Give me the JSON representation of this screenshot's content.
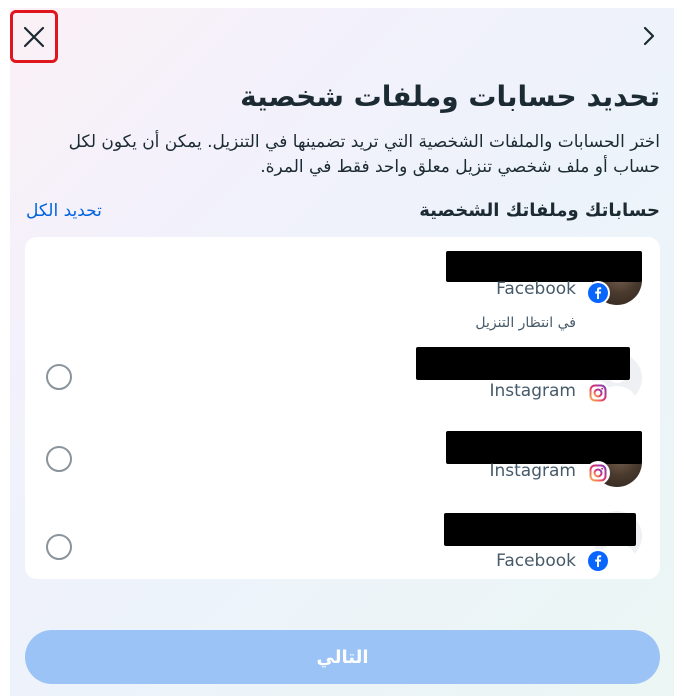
{
  "dialog": {
    "title": "تحديد حسابات وملفات شخصية",
    "description": "اختر الحسابات والملفات الشخصية التي تريد تضمينها في التنزيل. يمكن أن يكون لكل حساب أو ملف شخصي تنزيل معلق واحد فقط في المرة.",
    "section_title": "حساباتك وملفاتك الشخصية",
    "select_all_label": "تحديد الكل",
    "next_button_label": "التالي"
  },
  "accounts": [
    {
      "platform": "Facebook",
      "status": "في انتظار التنزيل",
      "selectable": false,
      "platform_icon": "facebook-icon",
      "avatar": "photo"
    },
    {
      "platform": "Instagram",
      "selectable": true,
      "selected": false,
      "platform_icon": "instagram-icon",
      "avatar": "blank"
    },
    {
      "platform": "Instagram",
      "selectable": true,
      "selected": false,
      "platform_icon": "instagram-icon",
      "avatar": "photo"
    },
    {
      "platform": "Facebook",
      "selectable": true,
      "selected": false,
      "platform_icon": "facebook-icon",
      "avatar": "blank"
    }
  ],
  "colors": {
    "link": "#0064e0",
    "next_button_disabled": "#9cc3f5",
    "close_highlight": "#e0161e",
    "facebook": "#0866ff",
    "instagram": "#d6249f"
  }
}
